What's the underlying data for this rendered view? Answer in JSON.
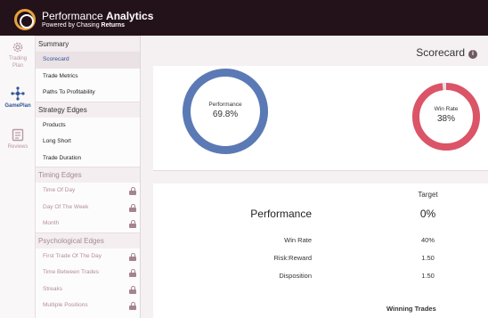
{
  "header": {
    "title_light": "Performance ",
    "title_bold": "Analytics",
    "subtitle_light": "Powered by Chasing ",
    "subtitle_bold": "Returns"
  },
  "rail": [
    {
      "label_line1": "Trading",
      "label_line2": "Plan",
      "icon": "gear-icon"
    },
    {
      "label_line1": "GamePlan",
      "label_line2": "",
      "icon": "network-icon"
    },
    {
      "label_line1": "Reviews",
      "label_line2": "",
      "icon": "clipboard-icon"
    }
  ],
  "menu": {
    "summary": {
      "label": "Summary",
      "items": [
        "Scorecard",
        "Trade Metrics",
        "Paths To Profitability"
      ]
    },
    "strategy": {
      "label": "Strategy Edges",
      "items": [
        "Products",
        "Long Short",
        "Trade Duration"
      ]
    },
    "timing": {
      "label": "Timing Edges",
      "items": [
        "Time Of Day",
        "Day Of The Week",
        "Month"
      ]
    },
    "psych": {
      "label": "Psychological Edges",
      "items": [
        "First Trade Of The Day",
        "Time Between Trades",
        "Streaks",
        "Multiple Positions"
      ]
    }
  },
  "page": {
    "title": "Scorecard",
    "info_glyph": "i"
  },
  "gauges": {
    "performance": {
      "label": "Performance",
      "value": "69.8%",
      "fraction": 1.0,
      "color": "#5b7ab5"
    },
    "win_rate": {
      "label": "Win Rate",
      "value": "38%",
      "fraction": 0.98,
      "color": "#db5467"
    }
  },
  "table": {
    "target_header": "Target",
    "headline": {
      "label": "Performance",
      "value": "0%"
    },
    "rows": [
      {
        "label": "Win Rate",
        "value": "40%"
      },
      {
        "label": "Risk:Reward",
        "value": "1.50"
      },
      {
        "label": "Disposition",
        "value": "1.50"
      }
    ],
    "section_below": "Winning Trades"
  },
  "colors": {
    "header_bg": "#24121a",
    "accent": "#2f5597",
    "lock": "#a58391"
  }
}
